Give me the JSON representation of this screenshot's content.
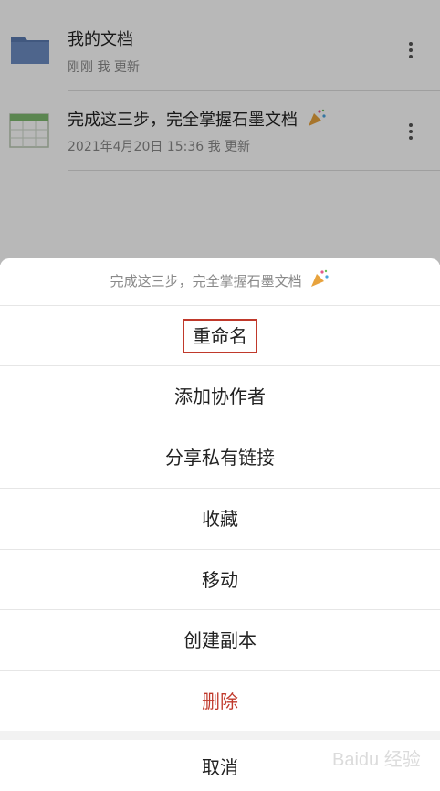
{
  "files": [
    {
      "title": "我的文档",
      "meta": "刚刚 我 更新",
      "icon": "folder-icon"
    },
    {
      "title": "完成这三步，完全掌握石墨文档",
      "meta": "2021年4月20日 15:36 我 更新",
      "icon": "spreadsheet-icon"
    }
  ],
  "sheet": {
    "header": "完成这三步，完全掌握石墨文档",
    "items": [
      {
        "label": "重命名"
      },
      {
        "label": "添加协作者"
      },
      {
        "label": "分享私有链接"
      },
      {
        "label": "收藏"
      },
      {
        "label": "移动"
      },
      {
        "label": "创建副本"
      },
      {
        "label": "删除"
      }
    ],
    "cancel": "取消"
  },
  "colors": {
    "danger": "#c0392b",
    "folder": "#5b7bb0",
    "spreadsheet": "#5aa35a"
  },
  "watermark": "Baidu 经验"
}
